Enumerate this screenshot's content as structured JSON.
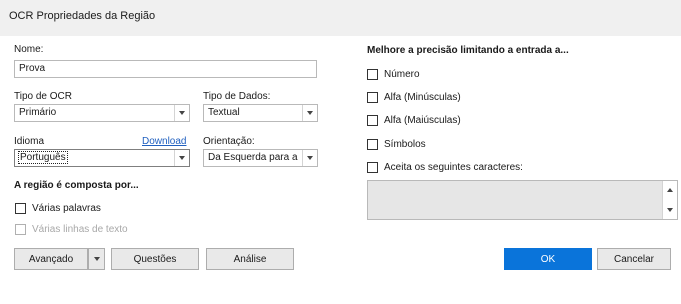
{
  "window": {
    "title": "OCR Propriedades da Região"
  },
  "name_field": {
    "label": "Nome:",
    "value": "Prova"
  },
  "ocr_type": {
    "label": "Tipo de OCR",
    "value": "Primário"
  },
  "data_type": {
    "label": "Tipo de Dados:",
    "value": "Textual"
  },
  "language": {
    "label": "Idioma",
    "download_link": "Download",
    "value": "Português"
  },
  "orientation": {
    "label": "Orientação:",
    "value": "Da Esquerda para a"
  },
  "region_section": {
    "heading": "A região é composta por...",
    "options": [
      {
        "label": "Várias palavras",
        "checked": false,
        "enabled": true
      },
      {
        "label": "Várias linhas de texto",
        "checked": false,
        "enabled": false
      }
    ]
  },
  "precision_section": {
    "heading": "Melhore a precisão limitando a entrada a...",
    "options": [
      {
        "label": "Número",
        "checked": false
      },
      {
        "label": "Alfa (Minúsculas)",
        "checked": false
      },
      {
        "label": "Alfa (Maiúsculas)",
        "checked": false
      },
      {
        "label": "Símbolos",
        "checked": false
      },
      {
        "label": "Aceita os seguintes caracteres:",
        "checked": false
      }
    ],
    "custom_chars_value": ""
  },
  "buttons": {
    "advanced": "Avançado",
    "questions": "Questões",
    "analysis": "Análise",
    "ok": "OK",
    "cancel": "Cancelar"
  }
}
